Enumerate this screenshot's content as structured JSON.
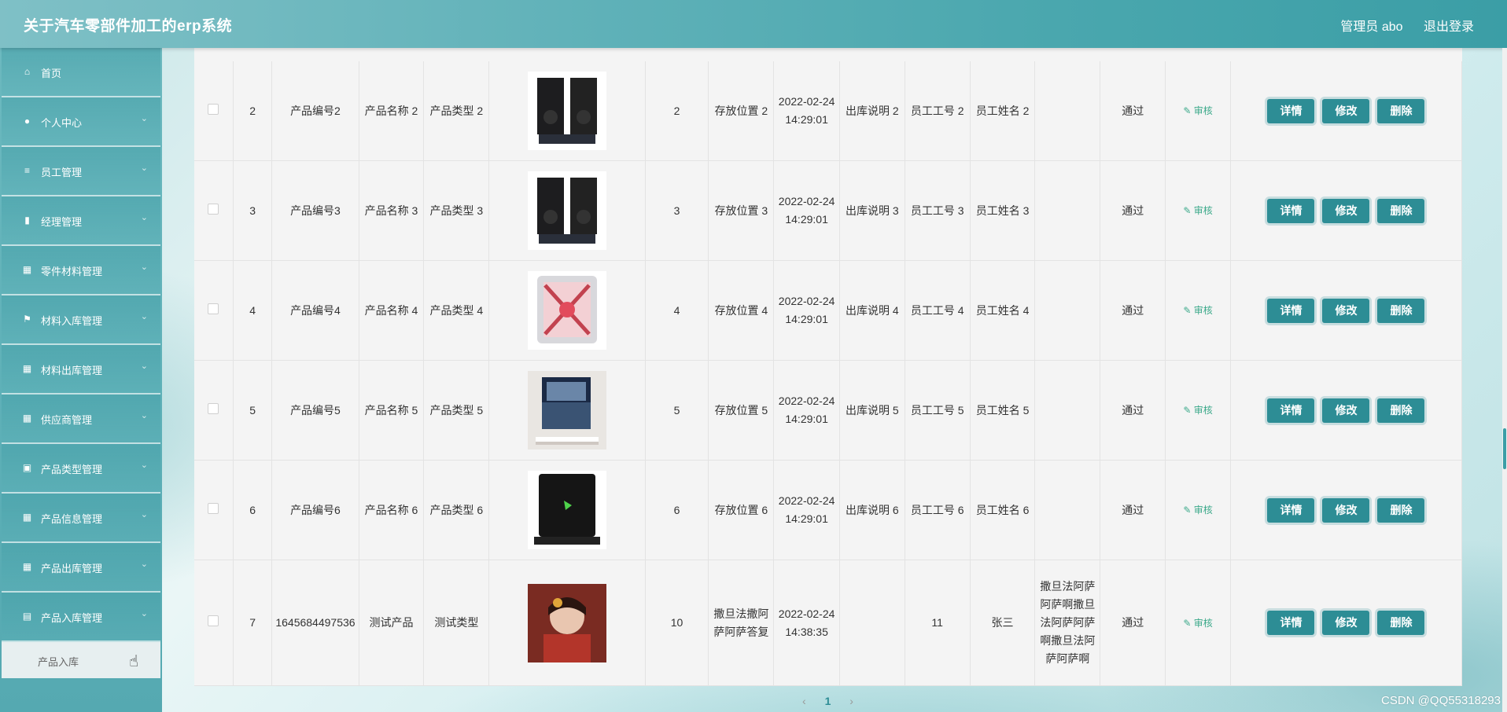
{
  "header": {
    "title": "关于汽车零部件加工的erp系统",
    "user": "管理员 abo",
    "logout": "退出登录"
  },
  "sidebar": {
    "items": [
      {
        "label": "首页",
        "icon": "home-icon",
        "glyph": "⌂"
      },
      {
        "label": "个人中心",
        "icon": "user-icon",
        "glyph": "●"
      },
      {
        "label": "员工管理",
        "icon": "list-icon",
        "glyph": "≡"
      },
      {
        "label": "经理管理",
        "icon": "chart-icon",
        "glyph": "▮"
      },
      {
        "label": "零件材料管理",
        "icon": "grid-icon",
        "glyph": "▦"
      },
      {
        "label": "材料入库管理",
        "icon": "flag-icon",
        "glyph": "⚑"
      },
      {
        "label": "材料出库管理",
        "icon": "grid-icon",
        "glyph": "▦"
      },
      {
        "label": "供应商管理",
        "icon": "grid-icon",
        "glyph": "▦"
      },
      {
        "label": "产品类型管理",
        "icon": "briefcase-icon",
        "glyph": "▣"
      },
      {
        "label": "产品信息管理",
        "icon": "grid-icon",
        "glyph": "▦"
      },
      {
        "label": "产品出库管理",
        "icon": "grid-icon",
        "glyph": "▦"
      },
      {
        "label": "产品入库管理",
        "icon": "printer-icon",
        "glyph": "▤"
      }
    ],
    "sub_item": "产品入库"
  },
  "table": {
    "rows": [
      {
        "index": "2",
        "code": "产品编号2",
        "name": "产品名称 2",
        "type": "产品类型 2",
        "image": "speaker-icon",
        "qty": "2",
        "location": "存放位置 2",
        "time": "2022-02-24 14:29:01",
        "note": "出库说明 2",
        "emp_no": "员工工号 2",
        "emp_name": "员工姓名 2",
        "reply": "",
        "status": "通过",
        "audit": "✎ 审核"
      },
      {
        "index": "3",
        "code": "产品编号3",
        "name": "产品名称 3",
        "type": "产品类型 3",
        "image": "speaker-icon",
        "qty": "3",
        "location": "存放位置 3",
        "time": "2022-02-24 14:29:01",
        "note": "出库说明 3",
        "emp_no": "员工工号 3",
        "emp_name": "员工姓名 3",
        "reply": "",
        "status": "通过",
        "audit": "✎ 审核"
      },
      {
        "index": "4",
        "code": "产品编号4",
        "name": "产品名称 4",
        "type": "产品类型 4",
        "image": "pc-case-icon",
        "qty": "4",
        "location": "存放位置 4",
        "time": "2022-02-24 14:29:01",
        "note": "出库说明 4",
        "emp_no": "员工工号 4",
        "emp_name": "员工姓名 4",
        "reply": "",
        "status": "通过",
        "audit": "✎ 审核"
      },
      {
        "index": "5",
        "code": "产品编号5",
        "name": "产品名称 5",
        "type": "产品类型 5",
        "image": "tv-icon",
        "qty": "5",
        "location": "存放位置 5",
        "time": "2022-02-24 14:29:01",
        "note": "出库说明 5",
        "emp_no": "员工工号 5",
        "emp_name": "员工姓名 5",
        "reply": "",
        "status": "通过",
        "audit": "✎ 审核"
      },
      {
        "index": "6",
        "code": "产品编号6",
        "name": "产品名称 6",
        "type": "产品类型 6",
        "image": "laptop-icon",
        "qty": "6",
        "location": "存放位置 6",
        "time": "2022-02-24 14:29:01",
        "note": "出库说明 6",
        "emp_no": "员工工号 6",
        "emp_name": "员工姓名 6",
        "reply": "",
        "status": "通过",
        "audit": "✎ 审核"
      },
      {
        "index": "7",
        "code": "1645684497536",
        "name": "测试产品",
        "type": "测试类型",
        "image": "portrait-photo",
        "qty": "10",
        "location": "撒旦法撒阿萨阿萨答复",
        "time": "2022-02-24 14:38:35",
        "note": "",
        "emp_no": "11",
        "emp_name": "张三",
        "reply": "撒旦法阿萨阿萨啊撒旦法阿萨阿萨啊撒旦法阿萨阿萨啊",
        "status": "通过",
        "audit": "✎ 审核"
      }
    ],
    "actions": {
      "detail": "详情",
      "edit": "修改",
      "delete": "删除"
    }
  },
  "pagination": {
    "prev": "‹",
    "current": "1",
    "next": "›"
  },
  "watermark": "CSDN @QQ55318293"
}
